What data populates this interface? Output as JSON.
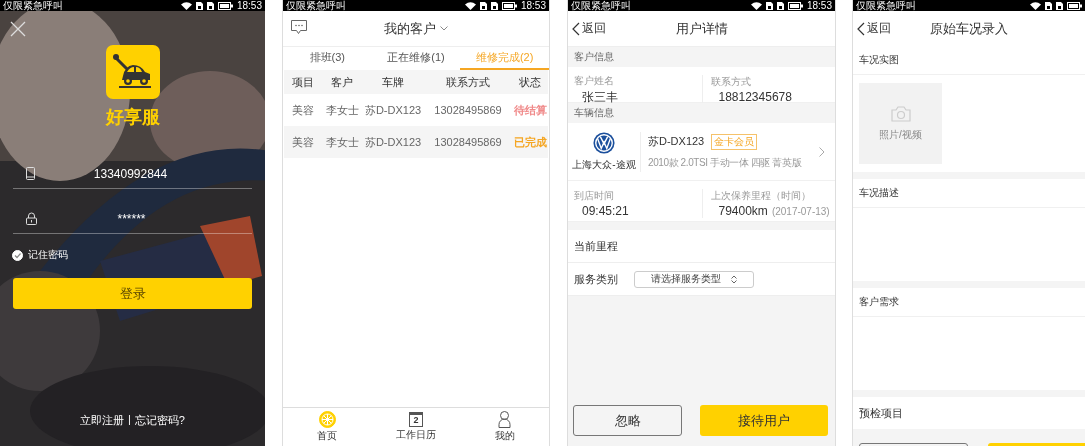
{
  "login_screen": {
    "status_bar": {
      "carrier": "仅限紧急呼叫",
      "time": "18:53"
    },
    "app_name": "好享服",
    "phone_field": {
      "value": "13340992844"
    },
    "password_field": {
      "value": "******"
    },
    "remember_password": {
      "label": "记住密码",
      "checked": true
    },
    "login_button": "登录",
    "links": [
      "立即注册",
      "忘记密码?"
    ],
    "link_separator": "|"
  },
  "customers_screen": {
    "status_bar": {
      "carrier": "仅限紧急呼叫",
      "time": "18:53"
    },
    "title": "我的客户",
    "tabs": [
      {
        "label": "排班(3)",
        "selected": false
      },
      {
        "label": "正在维修(1)",
        "selected": false
      },
      {
        "label": "维修完成(2)",
        "selected": true
      }
    ],
    "table": {
      "columns": [
        "项目",
        "客户",
        "车牌",
        "联系方式",
        "状态"
      ],
      "rows": [
        {
          "cells": [
            "美容",
            "李女士",
            "苏D-DX123",
            "13028495869"
          ],
          "status": "待结算",
          "color": "#f08a8a"
        },
        {
          "cells": [
            "美容",
            "李女士",
            "苏D-DX123",
            "13028495869"
          ],
          "status": "已完成",
          "color": "#f5a623"
        }
      ]
    },
    "bottom_nav": [
      {
        "label": "首页",
        "selected": true
      },
      {
        "label": "工作日历",
        "selected": false,
        "day": "2"
      },
      {
        "label": "我的",
        "selected": false
      }
    ]
  },
  "detail_screen": {
    "status_bar": {
      "carrier": "仅限紧急呼叫",
      "time": "18:53"
    },
    "back": "返回",
    "title": "用户详情",
    "customer_section": "客户信息",
    "customer_fields": [
      {
        "label": "客户姓名",
        "value": "张三丰"
      },
      {
        "label": "联系方式",
        "value": "18812345678"
      }
    ],
    "vehicle_section": "车辆信息",
    "vehicle": {
      "model": "上海大众-途观",
      "plate": "苏D-DX123",
      "badge": "金卡会员",
      "spec": "2010款 2.0TSI 手动一体 四驱 菁英版"
    },
    "visit_fields": [
      {
        "label": "到店时间",
        "value": "09:45:21"
      },
      {
        "label": "上次保养里程（时间）",
        "value": "79400km",
        "note": "(2017-07-13)"
      }
    ],
    "mileage_label": "当前里程",
    "service_type": {
      "label": "服务类别",
      "placeholder": "请选择服务类型"
    },
    "buttons": [
      {
        "label": "忽略",
        "kind": "secondary"
      },
      {
        "label": "接待用户",
        "kind": "primary"
      }
    ]
  },
  "condition_screen": {
    "status_bar": {
      "carrier": "仅限紧急呼叫"
    },
    "back": "返回",
    "title": "原始车况录入",
    "photo_section": "车况实图",
    "photo_placeholder": "照片/视频",
    "sections": [
      "车况描述",
      "客户需求"
    ],
    "precheck_label": "预检项目",
    "buttons": [
      {
        "kind": "secondary"
      },
      {
        "kind": "primary"
      }
    ]
  }
}
